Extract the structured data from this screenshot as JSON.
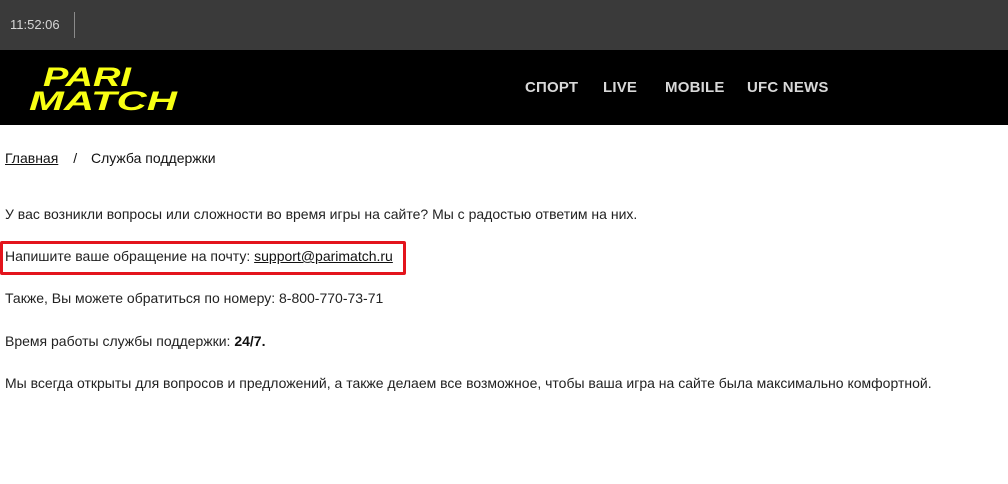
{
  "status_bar": {
    "time": "11:52:06"
  },
  "header": {
    "logo_line1": "PARI",
    "logo_line2": "MATCH",
    "nav": [
      {
        "label": "СПОРТ"
      },
      {
        "label": "LIVE"
      },
      {
        "label": "MOBILE"
      },
      {
        "label": "UFC NEWS"
      }
    ]
  },
  "breadcrumb": {
    "home": "Главная",
    "separator": "/",
    "current": "Служба поддержки"
  },
  "content": {
    "intro": "У вас возникли вопросы или сложности во время игры на сайте? Мы с радостью ответим на них.",
    "email_prefix": "Напишите ваше обращение на почту: ",
    "email": "support@parimatch.ru",
    "phone_text": "Также, Вы можете обратиться по номеру: 8-800-770-73-71",
    "hours_prefix": "Время работы службы поддержки: ",
    "hours_value": "24/7.",
    "closing": "Мы всегда открыты для вопросов и предложений, а также делаем все возможное, чтобы ваша игра на сайте была максимально комфортной."
  },
  "colors": {
    "header_bg": "#000000",
    "topbar_bg": "#3a3a3a",
    "logo_yellow": "#f8ff13",
    "highlight_red": "#e3141c"
  }
}
